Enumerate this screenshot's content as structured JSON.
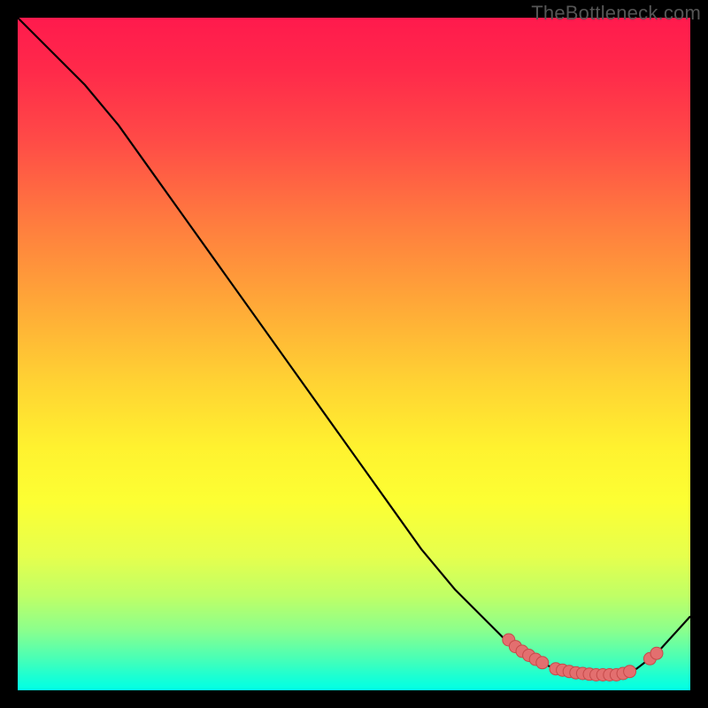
{
  "watermark": "TheBottleneck.com",
  "chart_data": {
    "type": "line",
    "title": "",
    "xlabel": "",
    "ylabel": "",
    "xlim": [
      0,
      100
    ],
    "ylim": [
      0,
      100
    ],
    "grid": false,
    "series": [
      {
        "name": "curve",
        "x": [
          0,
          5,
          10,
          15,
          20,
          25,
          30,
          35,
          40,
          45,
          50,
          55,
          60,
          65,
          70,
          73,
          76,
          78,
          80,
          82,
          84,
          86,
          88,
          90,
          92,
          95,
          100
        ],
        "y": [
          100,
          95,
          90,
          84,
          77,
          70,
          63,
          56,
          49,
          42,
          35,
          28,
          21,
          15,
          10,
          7,
          5,
          4,
          3.2,
          2.6,
          2.3,
          2.2,
          2.2,
          2.4,
          3.2,
          5.5,
          11
        ],
        "stroke": "#000000"
      }
    ],
    "markers": [
      {
        "x": 73,
        "y": 7.5
      },
      {
        "x": 74,
        "y": 6.5
      },
      {
        "x": 75,
        "y": 5.8
      },
      {
        "x": 76,
        "y": 5.2
      },
      {
        "x": 77,
        "y": 4.6
      },
      {
        "x": 78,
        "y": 4.1
      },
      {
        "x": 80,
        "y": 3.2
      },
      {
        "x": 81,
        "y": 3.0
      },
      {
        "x": 82,
        "y": 2.8
      },
      {
        "x": 83,
        "y": 2.6
      },
      {
        "x": 84,
        "y": 2.5
      },
      {
        "x": 85,
        "y": 2.4
      },
      {
        "x": 86,
        "y": 2.3
      },
      {
        "x": 87,
        "y": 2.3
      },
      {
        "x": 88,
        "y": 2.3
      },
      {
        "x": 89,
        "y": 2.3
      },
      {
        "x": 90,
        "y": 2.5
      },
      {
        "x": 91,
        "y": 2.8
      },
      {
        "x": 94,
        "y": 4.7
      },
      {
        "x": 95,
        "y": 5.5
      }
    ],
    "marker_style": {
      "fill": "#e36f6f",
      "stroke": "#c54a4a",
      "r": 7
    }
  }
}
